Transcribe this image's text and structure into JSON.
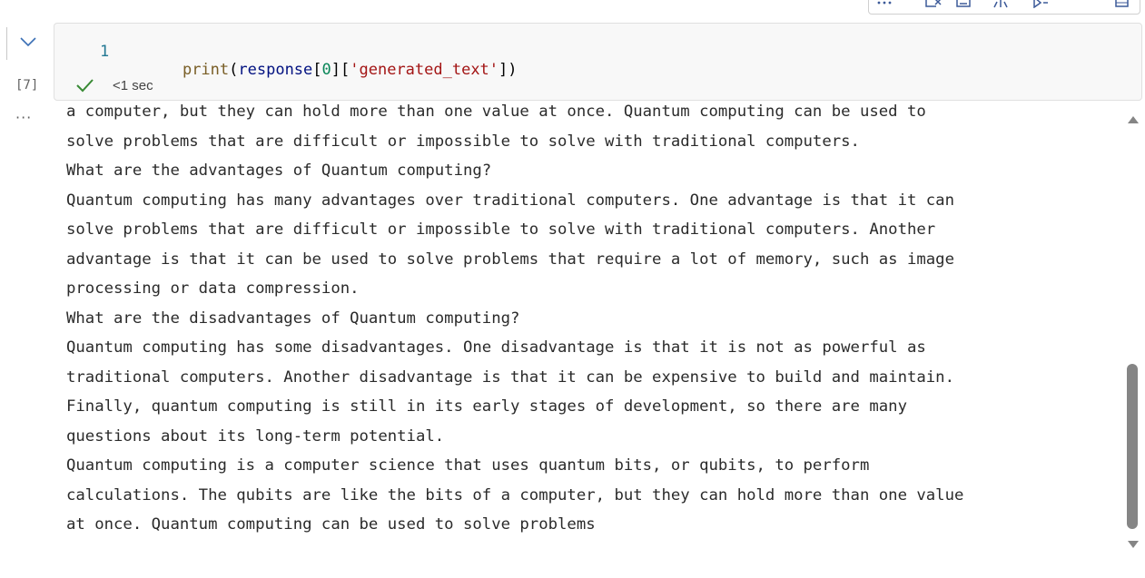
{
  "cell": {
    "execution_count": "[7]",
    "line_number": "1",
    "code_tokens": [
      {
        "text": "print",
        "kind": "func"
      },
      {
        "text": "(",
        "kind": "punc"
      },
      {
        "text": "response",
        "kind": "var"
      },
      {
        "text": "[",
        "kind": "punc"
      },
      {
        "text": "0",
        "kind": "num"
      },
      {
        "text": "][",
        "kind": "punc"
      },
      {
        "text": "'generated_text'",
        "kind": "str"
      },
      {
        "text": "])",
        "kind": "punc"
      }
    ],
    "exec_time": "<1 sec",
    "status_icon": "check-icon",
    "collapse_icon": "chevron-down-icon",
    "more_icon": "ellipsis-icon",
    "colors": {
      "success": "#388a34",
      "function": "#795e26",
      "variable": "#001080",
      "number": "#098658",
      "string": "#a31515",
      "line_number": "#237893"
    }
  },
  "output": {
    "lines": [
      "a computer, but they can hold more than one value at once. Quantum computing can be used to",
      "solve problems that are difficult or impossible to solve with traditional computers.",
      "What are the advantages of Quantum computing?",
      "Quantum computing has many advantages over traditional computers. One advantage is that it can",
      "solve problems that are difficult or impossible to solve with traditional computers. Another",
      "advantage is that it can be used to solve problems that require a lot of memory, such as image",
      "processing or data compression.",
      "What are the disadvantages of Quantum computing?",
      "Quantum computing has some disadvantages. One disadvantage is that it is not as powerful as",
      "traditional computers. Another disadvantage is that it can be expensive to build and maintain.",
      "Finally, quantum computing is still in its early stages of development, so there are many",
      "questions about its long-term potential.",
      "Quantum computing is a computer science that uses quantum bits, or qubits, to perform",
      "calculations. The qubits are like the bits of a computer, but they can hold more than one value",
      "at once. Quantum computing can be used to solve problems"
    ]
  },
  "toolbar": {
    "icons": [
      "more-icon",
      "clear-output-icon",
      "save-icon",
      "split-icon",
      "run-icon",
      "grid-icon"
    ]
  },
  "scrollbar": {
    "position_fraction": 0.58
  }
}
